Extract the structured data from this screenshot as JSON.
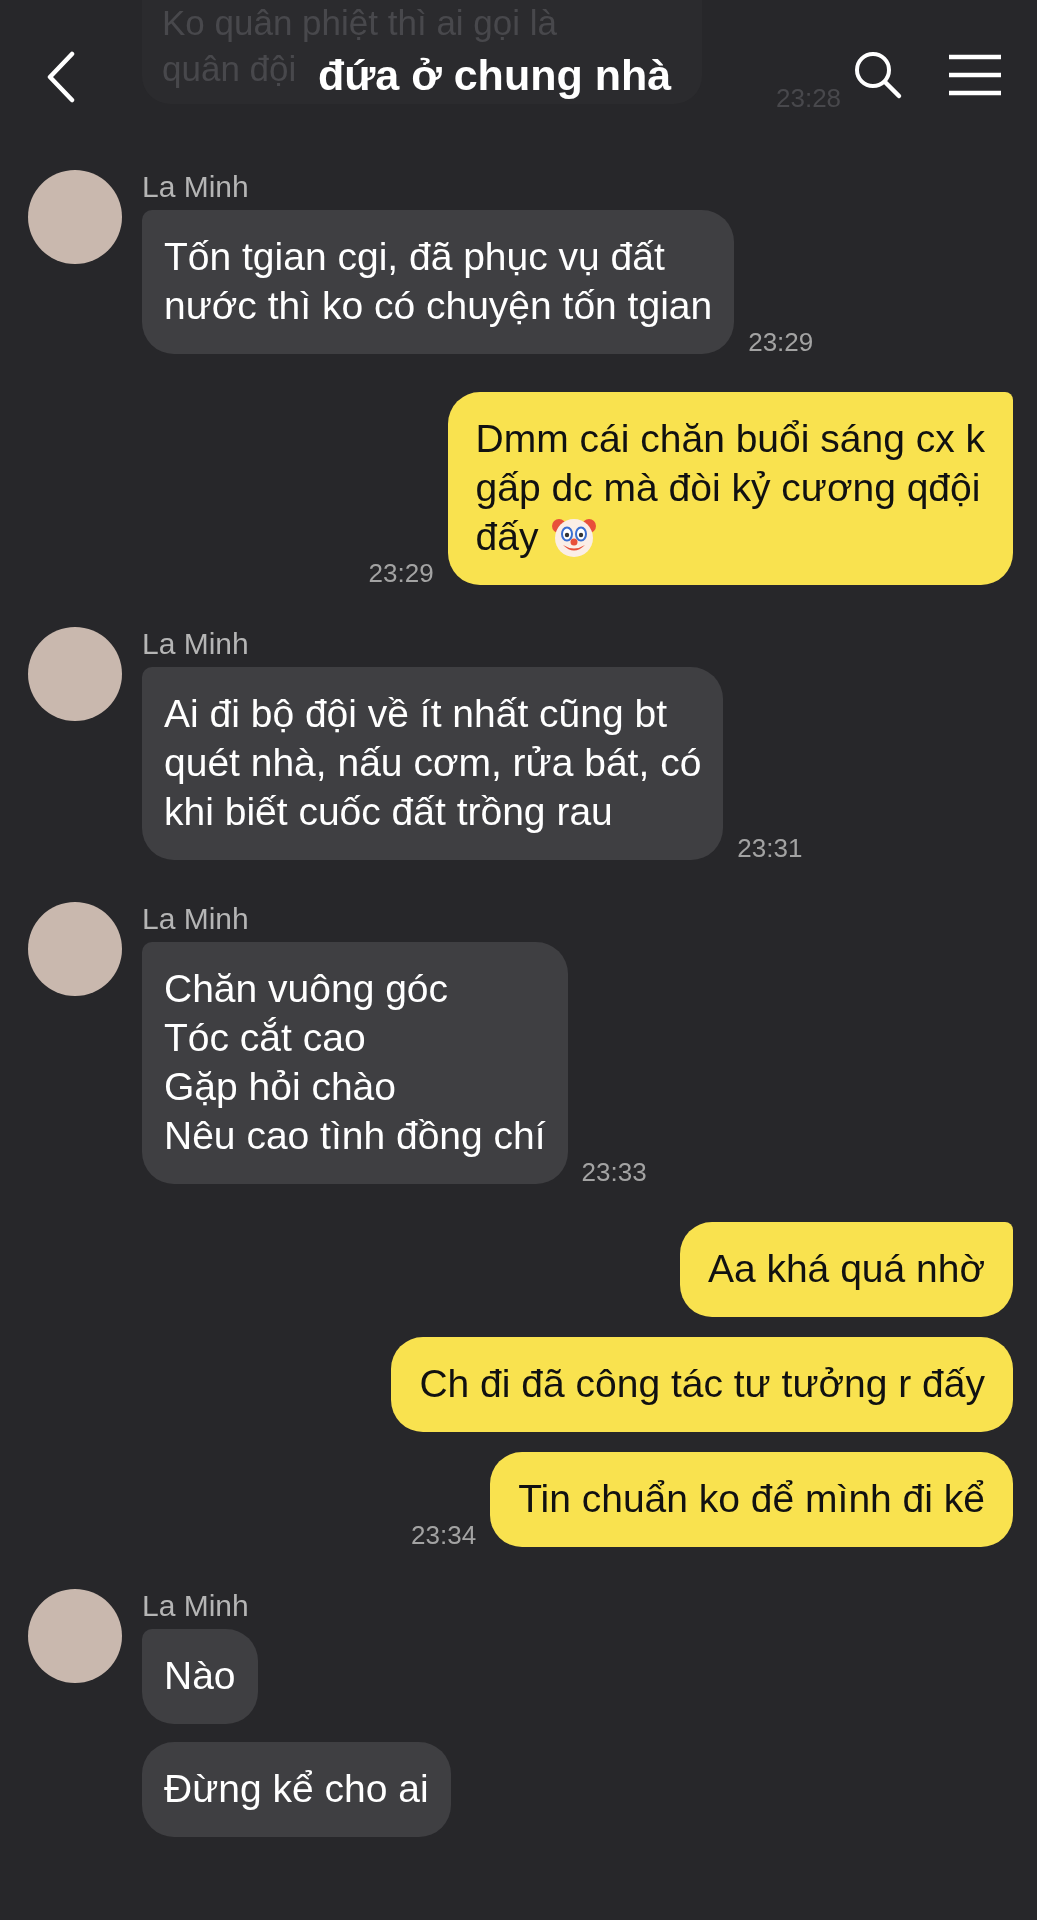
{
  "header": {
    "title": "đứa ở chung nhà"
  },
  "previous_message": {
    "text": "Ko quân phiệt thì ai gọi là\nquân đội",
    "time": "23:28"
  },
  "messages": [
    {
      "kind": "incoming",
      "sender": "La Minh",
      "tail": true,
      "text": "Tốn tgian cgi, đã phục vụ đất\nnước thì ko có chuyện tốn tgian",
      "time": "23:29"
    },
    {
      "kind": "outgoing",
      "tail": true,
      "lines": [
        "Dmm cái chăn buổi sáng cx k",
        "gấp dc mà đòi kỷ cương qđội",
        "đấy"
      ],
      "clown_emoji": true,
      "time": "23:29"
    },
    {
      "kind": "incoming",
      "sender": "La Minh",
      "tail": true,
      "text": "Ai đi bộ đội về ít nhất cũng bt\nquét nhà, nấu cơm, rửa bát, có\nkhi biết cuốc đất trồng rau",
      "time": "23:31"
    },
    {
      "kind": "incoming",
      "sender": "La Minh",
      "tail": true,
      "text": "Chăn vuông góc\nTóc cắt cao\nGặp hỏi chào\nNêu cao tình đồng chí",
      "time": "23:33"
    },
    {
      "kind": "outgoing",
      "tail": true,
      "text": "Aa khá quá nhờ"
    },
    {
      "kind": "outgoing",
      "tail": false,
      "text": "Ch đi đã công tác tư tưởng r đấy"
    },
    {
      "kind": "outgoing",
      "tail": false,
      "text": "Tin chuẩn ko để mình đi kể",
      "time": "23:34"
    },
    {
      "kind": "incoming",
      "sender": "La Minh",
      "tail": true,
      "text": "Nào"
    },
    {
      "kind": "incoming",
      "tail": false,
      "text": "Đừng kể cho ai"
    }
  ]
}
